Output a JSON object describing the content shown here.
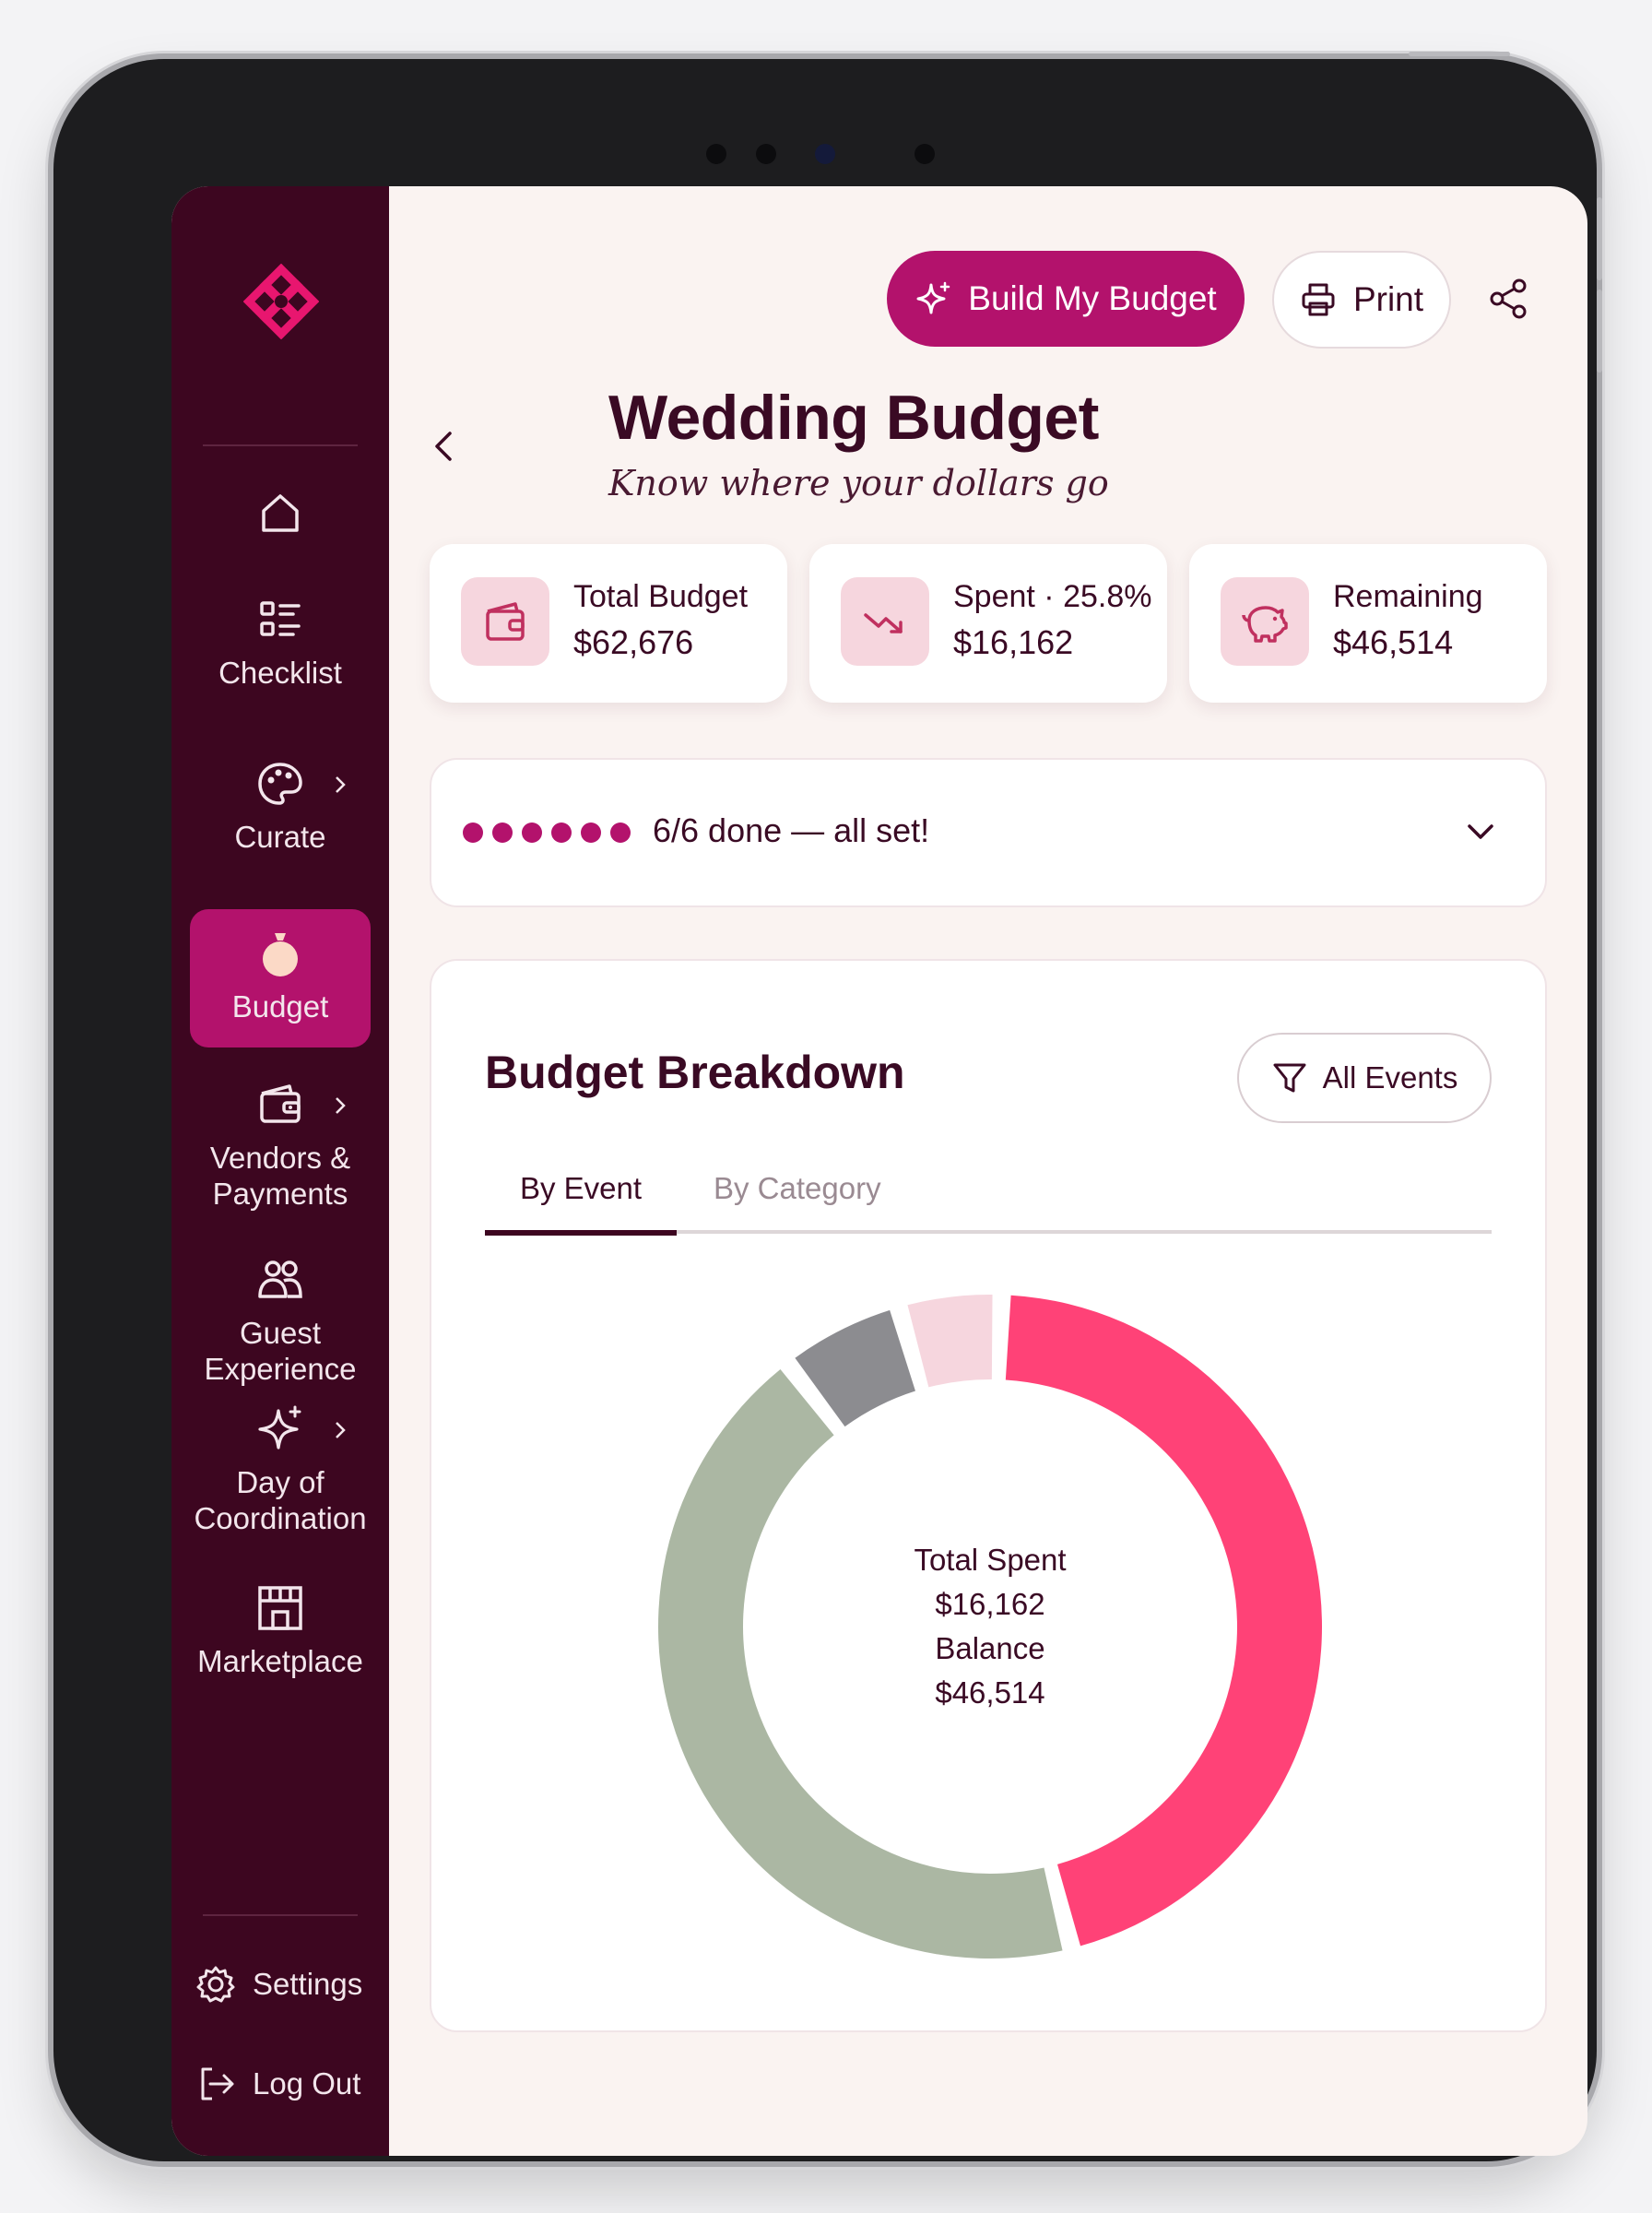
{
  "sidebar": {
    "items": [
      {
        "label": "",
        "icon": "home-icon"
      },
      {
        "label": "Checklist",
        "icon": "checklist-icon"
      },
      {
        "label": "Curate",
        "icon": "palette-icon"
      },
      {
        "label": "Budget",
        "icon": "money-bag-icon",
        "active": true
      },
      {
        "label": "Vendors & Payments",
        "icon": "wallet-icon"
      },
      {
        "label": "Guest Experience",
        "icon": "users-icon"
      },
      {
        "label": "Day of Coordination",
        "icon": "sparkle-icon"
      },
      {
        "label": "Marketplace",
        "icon": "storefront-icon"
      }
    ],
    "settings_label": "Settings",
    "logout_label": "Log Out"
  },
  "header": {
    "build_label": "Build My Budget",
    "print_label": "Print",
    "title": "Wedding Budget",
    "subtitle": "Know where your dollars go"
  },
  "stats": [
    {
      "label": "Total Budget",
      "value": "$62,676",
      "icon": "wallet-icon"
    },
    {
      "label": "Spent · 25.8%",
      "value": "$16,162",
      "icon": "trending-down-icon"
    },
    {
      "label": "Remaining",
      "value": "$46,514",
      "icon": "piggy-bank-icon"
    }
  ],
  "progress": {
    "done": 6,
    "total": 6,
    "text": "6/6 done — all set!"
  },
  "breakdown": {
    "title": "Budget Breakdown",
    "filter_label": "All Events",
    "tabs": [
      "By Event",
      "By Category"
    ],
    "active_tab": 0,
    "center": {
      "spent_label": "Total Spent",
      "spent_value": "$16,162",
      "balance_label": "Balance",
      "balance_value": "$46,514"
    }
  },
  "chart_data": {
    "type": "pie",
    "donut": true,
    "slices": [
      {
        "value": 45.5,
        "color": "#ff4277"
      },
      {
        "value": 43.5,
        "color": "#abb7a3"
      },
      {
        "value": 6,
        "color": "#8c8c90"
      },
      {
        "value": 5,
        "color": "#f6d6de"
      }
    ]
  },
  "colors": {
    "accent": "#b3126c",
    "sidebar_bg": "#3d0620",
    "text": "#3a0a24"
  }
}
